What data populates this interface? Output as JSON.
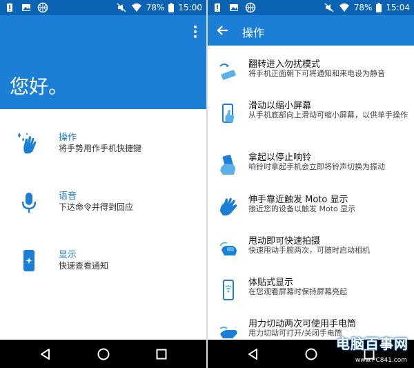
{
  "left": {
    "status": {
      "battery": "78%",
      "time": "15:00"
    },
    "greeting": "您好。",
    "features": [
      {
        "title": "操作",
        "desc": "将手势用作手机快捷键",
        "icon": "hand-wave-icon"
      },
      {
        "title": "语音",
        "desc": "下达命令并得到回应",
        "icon": "microphone-icon"
      },
      {
        "title": "显示",
        "desc": "快速查看通知",
        "icon": "phone-display-icon"
      }
    ]
  },
  "right": {
    "status": {
      "battery": "78%",
      "time": "15:04"
    },
    "title": "操作",
    "actions": [
      {
        "title": "翻转进入勿扰模式",
        "desc": "将手机正面朝下可将通知和来电设为静音",
        "icon": "flip-phone-icon"
      },
      {
        "title": "滑动以缩小屏幕",
        "desc": "从手机底部向上滑动可缩小屏幕，以供单手操作",
        "icon": "swipe-shrink-icon"
      },
      {
        "title": "拿起以停止响铃",
        "desc": "响铃时拿起手机会立即将铃声切换为振动",
        "icon": "pickup-phone-icon"
      },
      {
        "title": "伸手靠近触发 Moto 显示",
        "desc": "接近您的设备以触发 Moto 显示",
        "icon": "reach-hand-icon"
      },
      {
        "title": "甩动即可快速拍摄",
        "desc": "快速甩动手腕两次，可随时启动相机",
        "icon": "twist-camera-icon"
      },
      {
        "title": "体贴式显示",
        "desc": "在您观看屏幕时保持屏幕亮起",
        "icon": "attentive-display-icon"
      },
      {
        "title": "用力切动两次可使用手电筒",
        "desc": "用力切动可打开/关闭手电筒",
        "icon": "chop-flashlight-icon"
      }
    ]
  },
  "watermark": {
    "text": "电脑百事网",
    "sub": "www.PC841.com"
  }
}
